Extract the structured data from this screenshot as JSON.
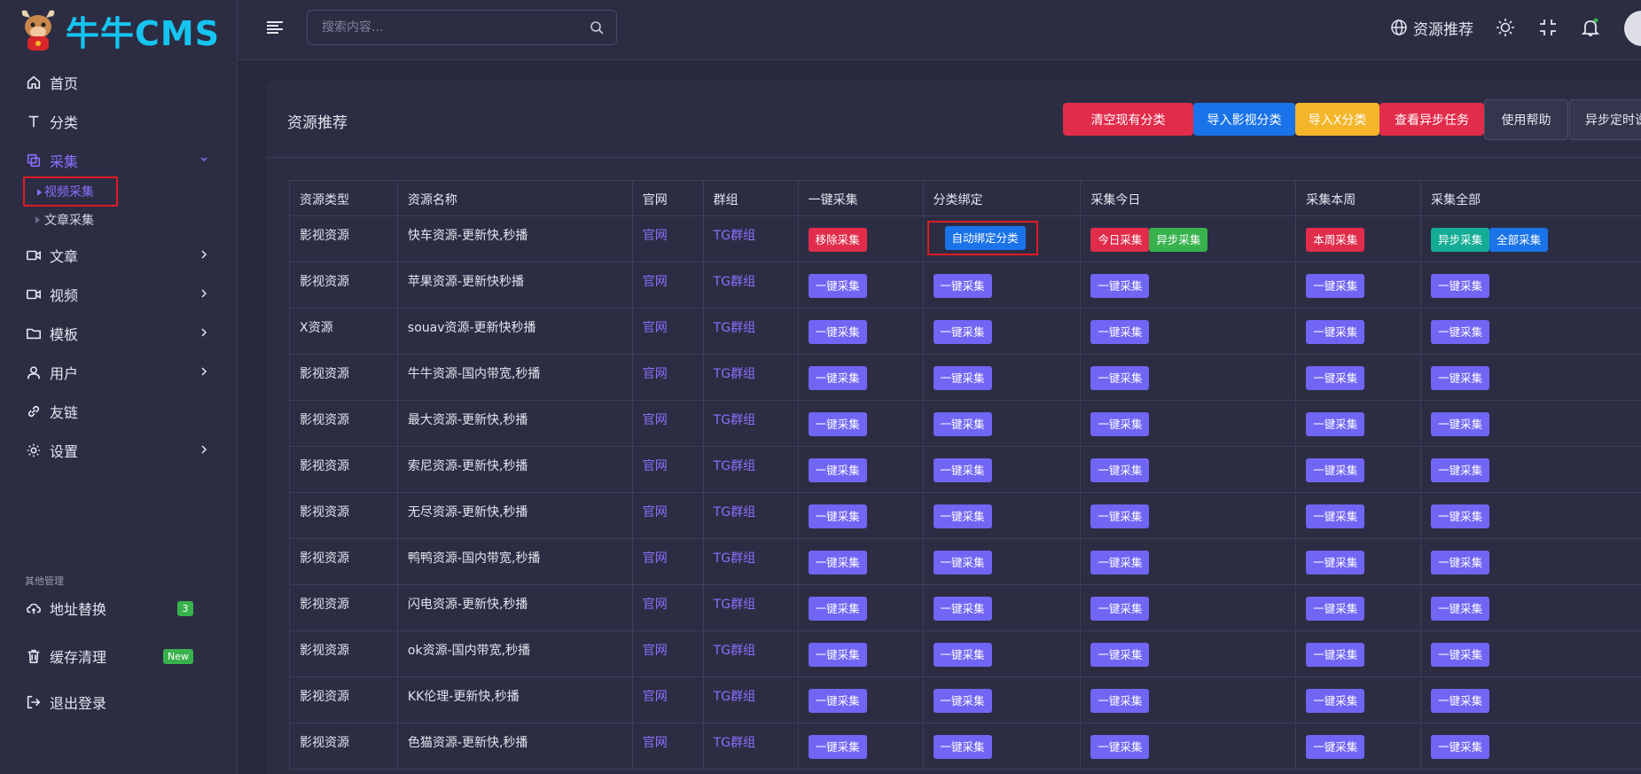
{
  "app": {
    "logo_text": "牛牛CMS"
  },
  "sidebar": {
    "items": [
      {
        "name": "home",
        "label": "首页",
        "icon": "home-icon"
      },
      {
        "name": "category",
        "label": "分类",
        "icon": "text-icon"
      },
      {
        "name": "collect",
        "label": "采集",
        "icon": "copy-icon",
        "expanded": true
      },
      {
        "name": "article",
        "label": "文章",
        "icon": "video-icon"
      },
      {
        "name": "video",
        "label": "视频",
        "icon": "video-icon"
      },
      {
        "name": "template",
        "label": "模板",
        "icon": "folder-icon"
      },
      {
        "name": "user",
        "label": "用户",
        "icon": "user-icon"
      },
      {
        "name": "links",
        "label": "友链",
        "icon": "link-icon"
      },
      {
        "name": "settings",
        "label": "设置",
        "icon": "gear-icon"
      }
    ],
    "sub_items": [
      {
        "label": "视频采集",
        "active": true
      },
      {
        "label": "文章采集",
        "active": false
      }
    ],
    "section_label": "其他管理",
    "other_items": [
      {
        "label": "地址替换",
        "badge": "3",
        "badge_color": "#37b24d"
      },
      {
        "label": "缓存清理",
        "badge": "New",
        "badge_color": "#37b24d"
      },
      {
        "label": "退出登录"
      }
    ]
  },
  "topbar": {
    "search_placeholder": "搜索内容...",
    "resource_link": "资源推荐"
  },
  "card": {
    "title": "资源推荐",
    "buttons": [
      {
        "label": "清空现有分类",
        "color": "#e22c4b"
      },
      {
        "label": "导入影视分类",
        "color": "#1a73e8"
      },
      {
        "label": "导入X分类",
        "color": "#f4b52a"
      },
      {
        "label": "查看异步任务",
        "color": "#e22c4b"
      },
      {
        "label": "使用帮助",
        "color": "#34364e"
      },
      {
        "label": "异步定时说明",
        "color": "#34364e"
      }
    ]
  },
  "table": {
    "headers": [
      "资源类型",
      "资源名称",
      "官网",
      "群组",
      "一键采集",
      "分类绑定",
      "采集今日",
      "采集本周",
      "采集全部"
    ],
    "first_row": {
      "type": "影视资源",
      "name": "快车资源-更新快,秒播",
      "site": "官网",
      "group": "TG群组",
      "collect": "移除采集",
      "bind": "自动绑定分类",
      "today": "今日采集",
      "today_async": "异步采集",
      "week": "本周采集",
      "all_async": "异步采集",
      "all": "全部采集"
    },
    "rows": [
      {
        "type": "影视资源",
        "name": "苹果资源-更新快秒播",
        "site": "官网",
        "group": "TG群组"
      },
      {
        "type": "X资源",
        "name": "souav资源-更新快秒播",
        "site": "官网",
        "group": "TG群组"
      },
      {
        "type": "影视资源",
        "name": "牛牛资源-国内带宽,秒播",
        "site": "官网",
        "group": "TG群组"
      },
      {
        "type": "影视资源",
        "name": "最大资源-更新快,秒播",
        "site": "官网",
        "group": "TG群组"
      },
      {
        "type": "影视资源",
        "name": "索尼资源-更新快,秒播",
        "site": "官网",
        "group": "TG群组"
      },
      {
        "type": "影视资源",
        "name": "无尽资源-更新快,秒播",
        "site": "官网",
        "group": "TG群组"
      },
      {
        "type": "影视资源",
        "name": "鸭鸭资源-国内带宽,秒播",
        "site": "官网",
        "group": "TG群组"
      },
      {
        "type": "影视资源",
        "name": "闪电资源-更新快,秒播",
        "site": "官网",
        "group": "TG群组"
      },
      {
        "type": "影视资源",
        "name": "ok资源-国内带宽,秒播",
        "site": "官网",
        "group": "TG群组"
      },
      {
        "type": "影视资源",
        "name": "KK伦理-更新快,秒播",
        "site": "官网",
        "group": "TG群组"
      },
      {
        "type": "影视资源",
        "name": "色猫资源-更新快,秒播",
        "site": "官网",
        "group": "TG群组"
      }
    ],
    "action_label": "一键采集"
  },
  "colors": {
    "accent": "#8a70ff",
    "button_purple": "#7165f4",
    "button_red": "#e22c4b",
    "button_green": "#37b24d",
    "button_teal": "#15ac95",
    "button_blue": "#1a73e8",
    "button_yellow": "#f4b52a",
    "logo": "#16c4f0"
  }
}
